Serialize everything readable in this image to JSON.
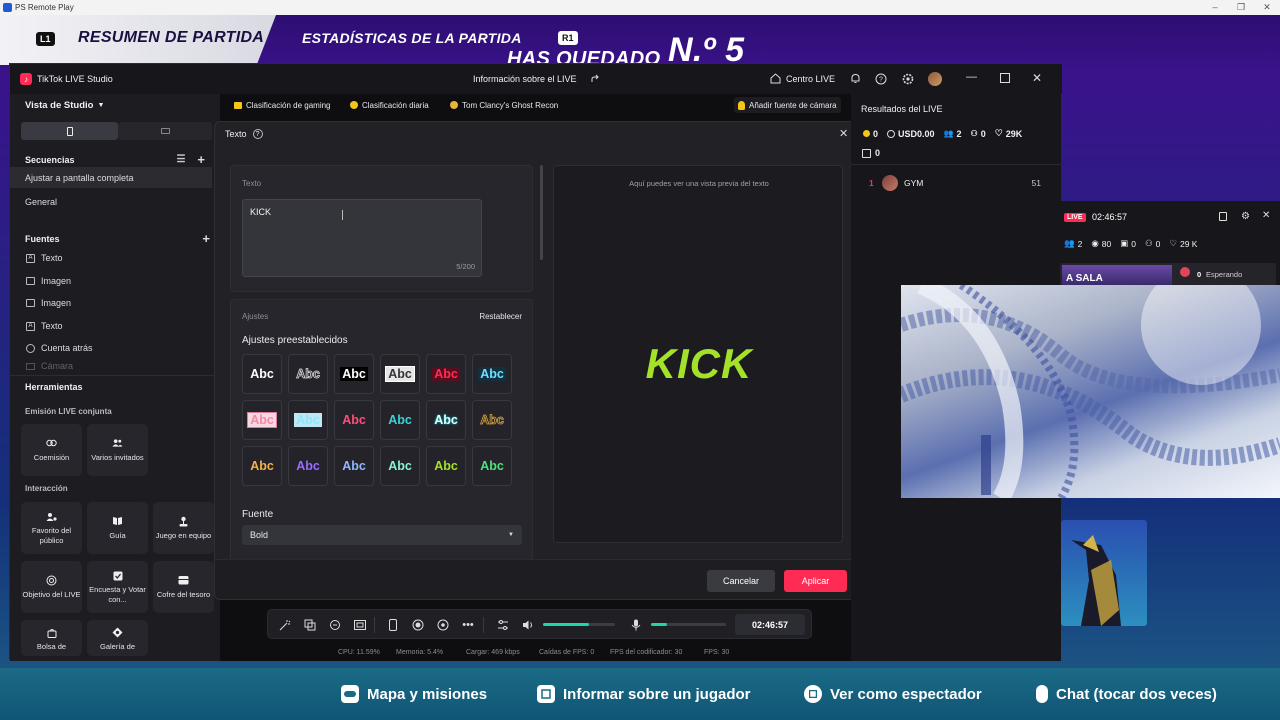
{
  "ps_window": {
    "title": "PS Remote Play"
  },
  "game": {
    "l1": "L1",
    "summary": "RESUMEN DE PARTIDA",
    "stats": "ESTADÍSTICAS DE LA PARTIDA",
    "r1": "R1",
    "placed": "HAS QUEDADO",
    "place_number": "N.º 5",
    "bottom_actions": [
      {
        "label": "Mapa y misiones",
        "icon": "gamepad-icon"
      },
      {
        "label": "Informar sobre un jugador",
        "icon": "report-icon"
      },
      {
        "label": "Ver como espectador",
        "icon": "square-button-icon"
      },
      {
        "label": "Chat (tocar dos veces)",
        "icon": "touchpad-icon"
      }
    ]
  },
  "studio": {
    "title": "TikTok LIVE Studio",
    "center_title": "Información sobre el LIVE",
    "centro_live": "Centro LIVE",
    "view_label": "Vista de Studio",
    "sections": {
      "secuencias": "Secuencias",
      "sequence_items": [
        "Ajustar a pantalla completa",
        "General"
      ],
      "fuentes": "Fuentes",
      "source_items": [
        {
          "label": "Texto",
          "icon": "text-icon"
        },
        {
          "label": "Imagen",
          "icon": "image-icon"
        },
        {
          "label": "Imagen",
          "icon": "image-icon"
        },
        {
          "label": "Texto",
          "icon": "text-icon"
        },
        {
          "label": "Cuenta atrás",
          "icon": "countdown-icon"
        },
        {
          "label": "Cámara",
          "icon": "camera-icon"
        }
      ],
      "herramientas": "Herramientas",
      "emision": "Emisión LIVE conjunta",
      "emision_tools": [
        "Coemisión",
        "Varios invitados"
      ],
      "interaccion": "Interacción",
      "interaction_tools": [
        "Favorito del público",
        "Guía",
        "Juego en equipo",
        "Objetivo del LIVE",
        "Encuesta y Votar con...",
        "Cofre del tesoro",
        "Bolsa de",
        "Galería de"
      ]
    },
    "chips": [
      "Clasificación de gaming",
      "Clasificación diaria",
      "Tom Clancy's Ghost Recon"
    ],
    "add_camera": "Añadir fuente de cámara",
    "results": {
      "title": "Resultados del LIVE",
      "coins": "0",
      "usd": "USD0.00",
      "viewers": "2",
      "shares": "0",
      "likes": "29K",
      "gifts": "0",
      "ranking": [
        {
          "rank": "1",
          "name": "GYM",
          "score": "51"
        }
      ]
    },
    "controls": {
      "time": "02:46:57"
    },
    "status": {
      "cpu": "CPU: 11.59%",
      "mem": "Memoria: 5.4%",
      "upload": "Cargar: 469 kbps",
      "drops": "Caídas de FPS: 0",
      "encoder": "FPS del codificador: 30",
      "fps": "FPS: 30"
    }
  },
  "dialog": {
    "title": "Texto",
    "text_label": "Texto",
    "text_value": "KICK",
    "counter": "5/200",
    "settings_label": "Ajustes",
    "reset": "Restablecer",
    "presets_label": "Ajustes preestablecidos",
    "preset_sample": "Abc",
    "font_label": "Fuente",
    "font_value": "Bold",
    "preview_hint": "Aquí puedes ver una vista previa del texto",
    "preview_text": "KICK",
    "preview_color": "#a4e22a",
    "cancel": "Cancelar",
    "apply": "Aplicar",
    "apply_color": "#fe2c55"
  },
  "live_widget": {
    "badge": "LIVE",
    "time": "02:46:57",
    "viewers": "2",
    "views": "80",
    "gifts": "0",
    "shares": "0",
    "likes": "29 K",
    "waiting_count": "0",
    "waiting": "Esperando",
    "thumb_text": "A SALA"
  },
  "colors": {
    "accent": "#fe2c55",
    "slider": "#1ed6a8",
    "bg": "#141418"
  }
}
